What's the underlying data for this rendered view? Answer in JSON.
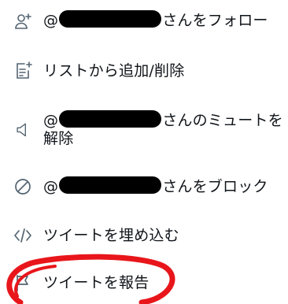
{
  "menu": {
    "items": [
      {
        "icon": "follow-user-icon",
        "prefix": "@",
        "suffix": "さんをフォロー"
      },
      {
        "icon": "list-add-icon",
        "label": "リストから追加/削除"
      },
      {
        "icon": "mute-speaker-icon",
        "prefix": "@",
        "suffix": "さんのミュートを",
        "line2": "解除"
      },
      {
        "icon": "block-icon",
        "prefix": "@",
        "suffix": "さんをブロック"
      },
      {
        "icon": "embed-code-icon",
        "label": "ツイートを埋め込む"
      },
      {
        "icon": "report-flag-icon",
        "label": "ツイートを報告"
      }
    ]
  },
  "colors": {
    "text": "#0f1419",
    "icon": "#536471",
    "redaction": "#000000",
    "annotation": "#e8161b"
  }
}
